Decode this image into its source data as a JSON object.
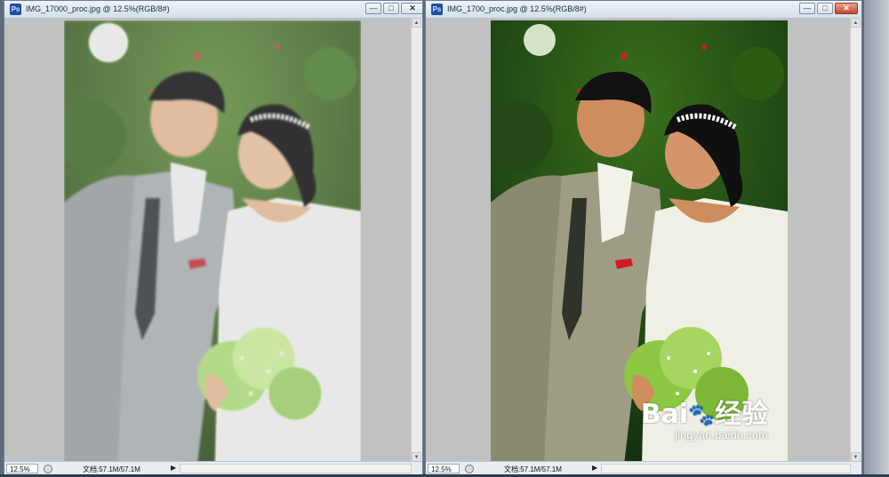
{
  "windows": [
    {
      "title": "IMG_17000_proc.jpg @ 12.5%(RGB/8#)",
      "zoom": "12.5%",
      "doc_info": "文档:57.1M/57.1M",
      "buttons": {
        "minimize": "—",
        "maximize": "□",
        "close": "✕"
      }
    },
    {
      "title": "IMG_1700_proc.jpg @ 12.5%(RGB/8#)",
      "zoom": "12.5%",
      "doc_info": "文档:57.1M/57.1M",
      "buttons": {
        "minimize": "—",
        "maximize": "□",
        "close": "✕"
      }
    }
  ],
  "watermark": {
    "brand": "Bai",
    "brand2": "经验",
    "url": "jingyan.baidu.com"
  },
  "app_icon": "Ps",
  "scroll_up": "▲",
  "scroll_down": "▼",
  "status_arrow": "▶"
}
